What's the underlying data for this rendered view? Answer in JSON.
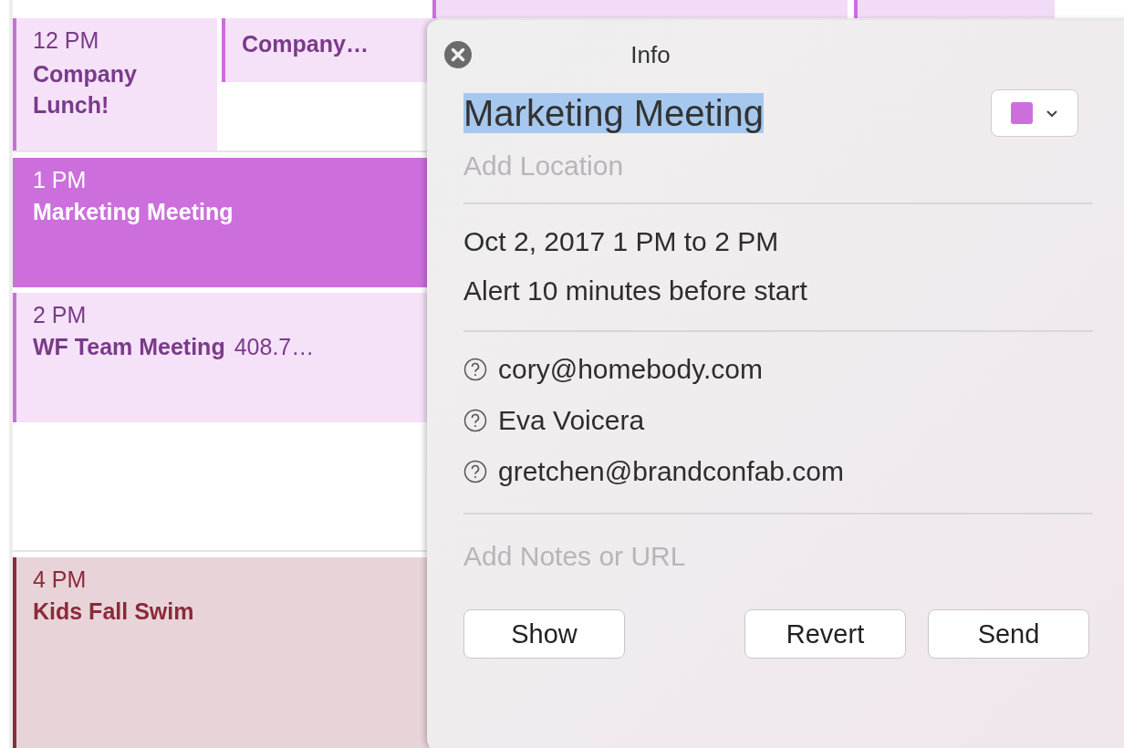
{
  "calendar": {
    "top_events": [
      {
        "color": "#cc6fdc"
      },
      {
        "color": "#cc6fdc"
      }
    ],
    "events": [
      {
        "time": "12 PM",
        "title": "Company Lunch!",
        "color": "#cc6fdc",
        "selected": false,
        "kind": "left"
      },
      {
        "title": "Company…",
        "color": "#cc6fdc",
        "selected": false,
        "kind": "right"
      },
      {
        "time": "1 PM",
        "title": "Marketing Meeting",
        "color": "#cc6fdc",
        "selected": true,
        "kind": "full"
      },
      {
        "time": "2 PM",
        "title": "WF Team Meeting",
        "detail": "408.7…",
        "color": "#cc6fdc",
        "selected": false,
        "kind": "full"
      },
      {
        "time": "4 PM",
        "title": "Kids Fall Swim",
        "color": "#8b2a3a",
        "selected": false,
        "kind": "full"
      }
    ]
  },
  "popover": {
    "title": "Info",
    "event_title": "Marketing Meeting",
    "title_selected": true,
    "color": "#cc6fdc",
    "location_placeholder": "Add Location",
    "date": "Oct 2, 2017  1 PM to 2 PM",
    "alert": "Alert 10 minutes before start",
    "invitees": [
      {
        "name": "cory@homebody.com",
        "kind": "unknown"
      },
      {
        "name": "Eva Voicera",
        "kind": "unknown"
      },
      {
        "name": "gretchen@brandconfab.com",
        "kind": "unknown"
      }
    ],
    "notes_placeholder": "Add Notes or URL",
    "buttons": [
      "Show",
      "Revert",
      "Send"
    ]
  }
}
